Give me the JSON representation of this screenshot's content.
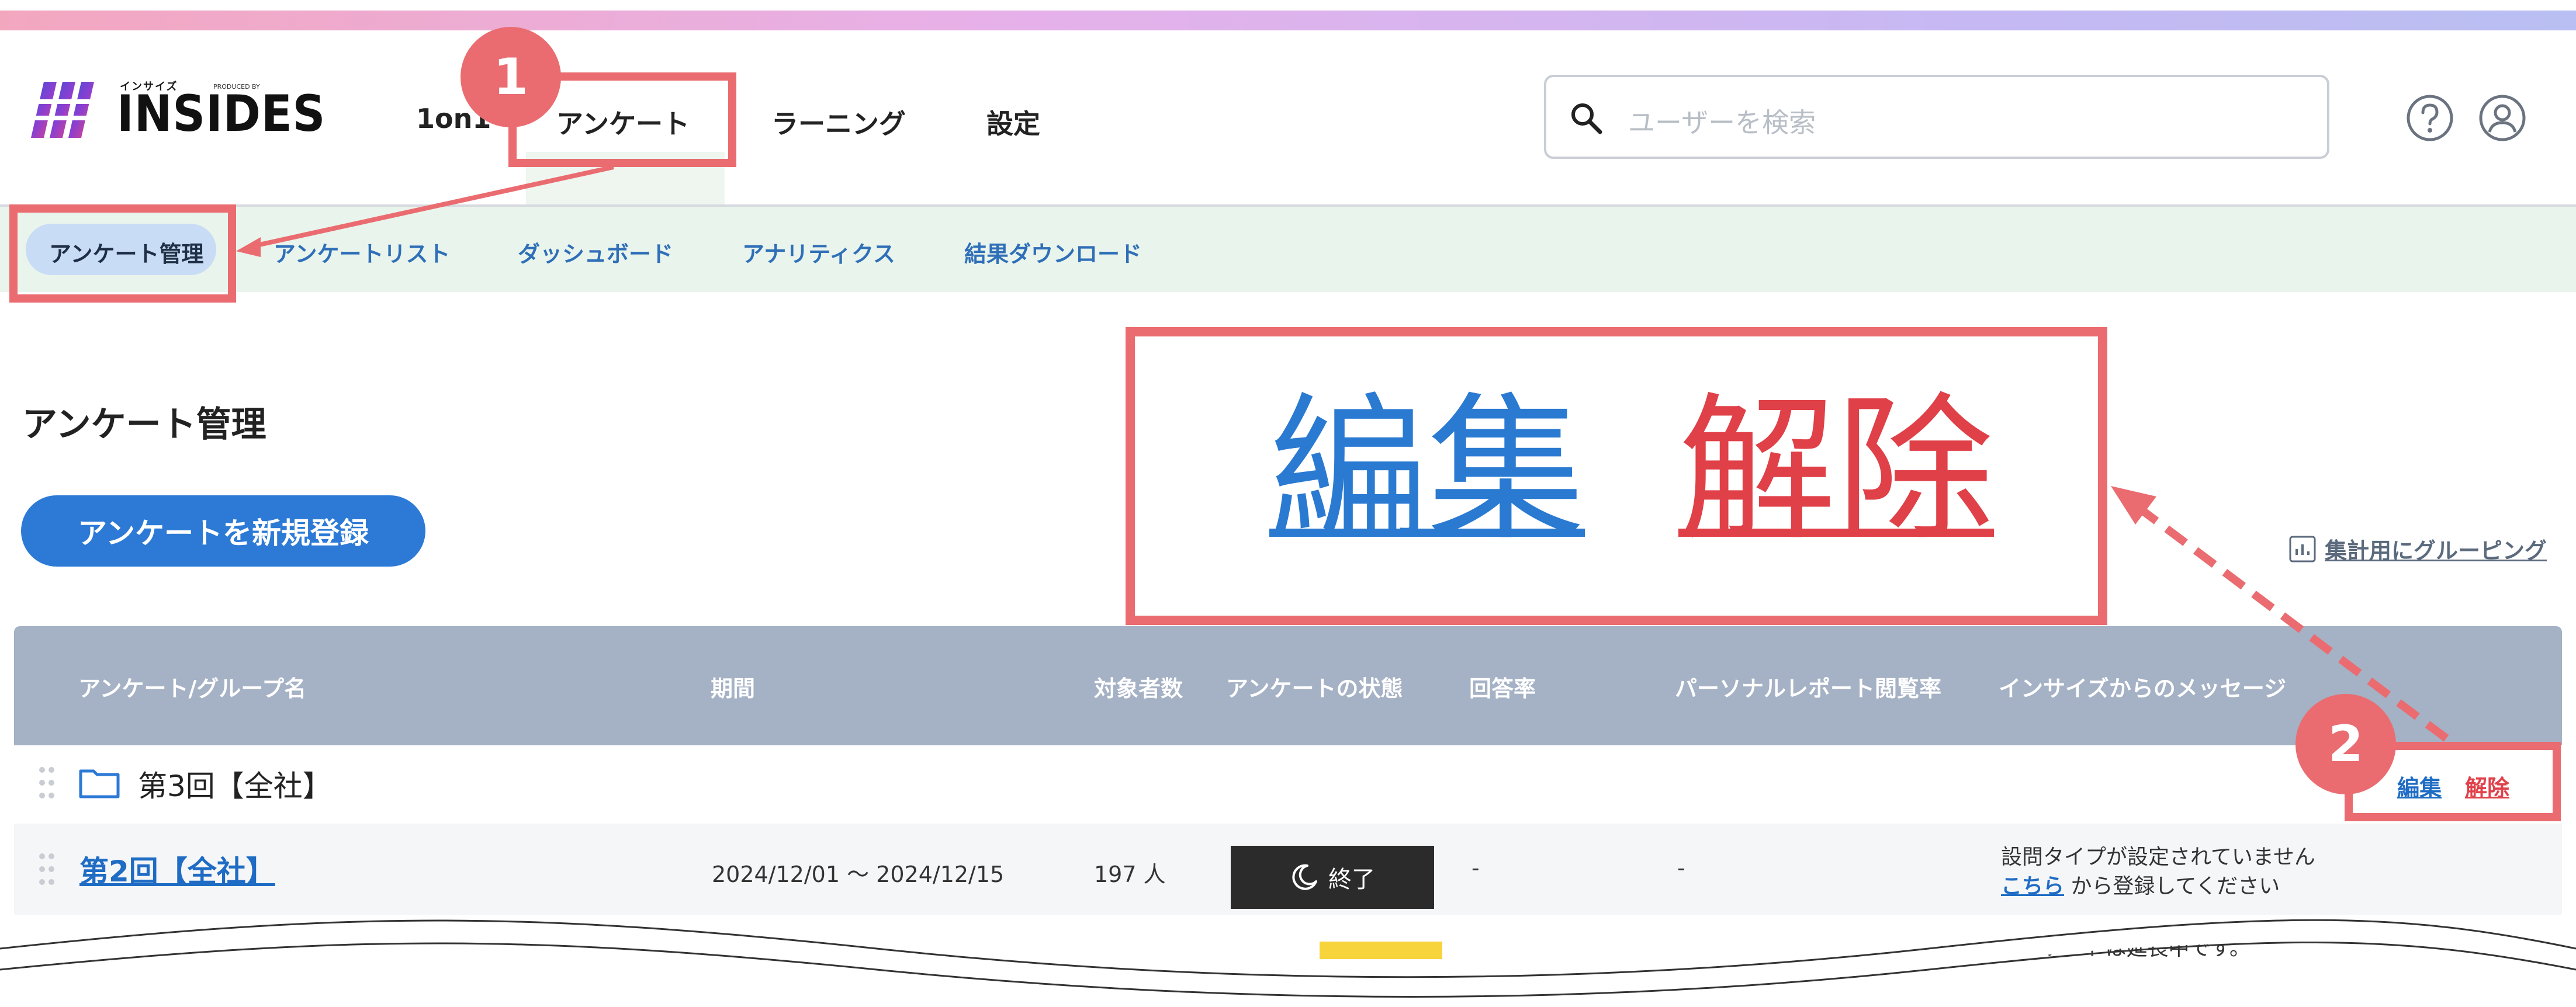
{
  "header": {
    "logo_small": "インサイズ",
    "logo_produced": "PRODUCED BY",
    "logo_text": "INSIDES",
    "nav": [
      {
        "label": "1on1"
      },
      {
        "label": "アンケート"
      },
      {
        "label": "ラーニング"
      },
      {
        "label": "設定"
      }
    ],
    "search_placeholder": "ユーザーを検索"
  },
  "subnav": {
    "items": [
      {
        "label": "アンケート管理"
      },
      {
        "label": "アンケートリスト"
      },
      {
        "label": "ダッシュボード"
      },
      {
        "label": "アナリティクス"
      },
      {
        "label": "結果ダウンロード"
      }
    ]
  },
  "page": {
    "title": "アンケート管理",
    "new_button": "アンケートを新規登録",
    "group_link": "集計用にグルーピング"
  },
  "table": {
    "headers": [
      "アンケート/グループ名",
      "期間",
      "対象者数",
      "アンケートの状態",
      "回答率",
      "パーソナルレポート閲覧率",
      "インサイズからのメッセージ"
    ],
    "group_row": {
      "name": "第3回【全社】",
      "edit": "編集",
      "release": "解除"
    },
    "survey_row": {
      "name": "第2回【全社】",
      "period": "2024/12/01 〜 2024/12/15",
      "targets": "197 人",
      "status": "終了",
      "response_rate": "-",
      "report_rate": "-",
      "message_line1": "設問タイプが設定されていません",
      "message_link": "こちら",
      "message_line2_rest": " から登録してください"
    },
    "peek_row": {
      "message": "アンケートは延長中です。"
    }
  },
  "annotations": {
    "step1": "1",
    "step2": "2",
    "zoom_edit": "編集",
    "zoom_release": "解除",
    "color": "#ea6c70"
  },
  "colors": {
    "primary": "#2c7ad6",
    "link": "#1f6cc4",
    "danger": "#e0414b",
    "table_header": "#a5b1c4",
    "subnav_bg": "#e9f4ec"
  }
}
